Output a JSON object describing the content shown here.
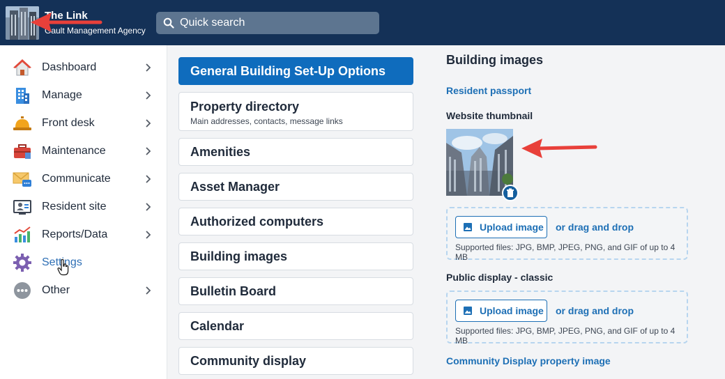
{
  "header": {
    "title": "The Link",
    "subtitle": "Gault Management Agency",
    "search_placeholder": "Quick search"
  },
  "sidebar": {
    "items": [
      {
        "label": "Dashboard",
        "icon": "house-icon",
        "chevron": true
      },
      {
        "label": "Manage",
        "icon": "building-icon",
        "chevron": true
      },
      {
        "label": "Front desk",
        "icon": "bell-icon",
        "chevron": true
      },
      {
        "label": "Maintenance",
        "icon": "toolbox-icon",
        "chevron": true
      },
      {
        "label": "Communicate",
        "icon": "envelope-icon",
        "chevron": true
      },
      {
        "label": "Resident site",
        "icon": "resident-site-icon",
        "chevron": true
      },
      {
        "label": "Reports/Data",
        "icon": "chart-icon",
        "chevron": true
      },
      {
        "label": "Settings",
        "icon": "gear-icon",
        "chevron": false,
        "active": true
      },
      {
        "label": "Other",
        "icon": "more-icon",
        "chevron": true
      }
    ]
  },
  "options": {
    "items": [
      {
        "title": "General Building Set-Up Options",
        "active": true
      },
      {
        "title": "Property directory",
        "subtitle": "Main addresses, contacts, message links"
      },
      {
        "title": "Amenities"
      },
      {
        "title": "Asset Manager"
      },
      {
        "title": "Authorized computers"
      },
      {
        "title": "Building images"
      },
      {
        "title": "Bulletin Board"
      },
      {
        "title": "Calendar"
      },
      {
        "title": "Community display"
      }
    ]
  },
  "panel": {
    "title": "Building images",
    "resident_passport": "Resident passport",
    "website_thumbnail": "Website thumbnail",
    "upload_label": "Upload image",
    "drag_label": "or drag and drop",
    "supported": "Supported files: JPG, BMP, JPEG, PNG, and GIF of up to 4 MB",
    "public_display": "Public display - classic",
    "community_display_image": "Community Display property image"
  },
  "colors": {
    "header": "#143157",
    "accent": "#0f6cbd",
    "link": "#1d6fb5",
    "arrow": "#e8403a"
  }
}
